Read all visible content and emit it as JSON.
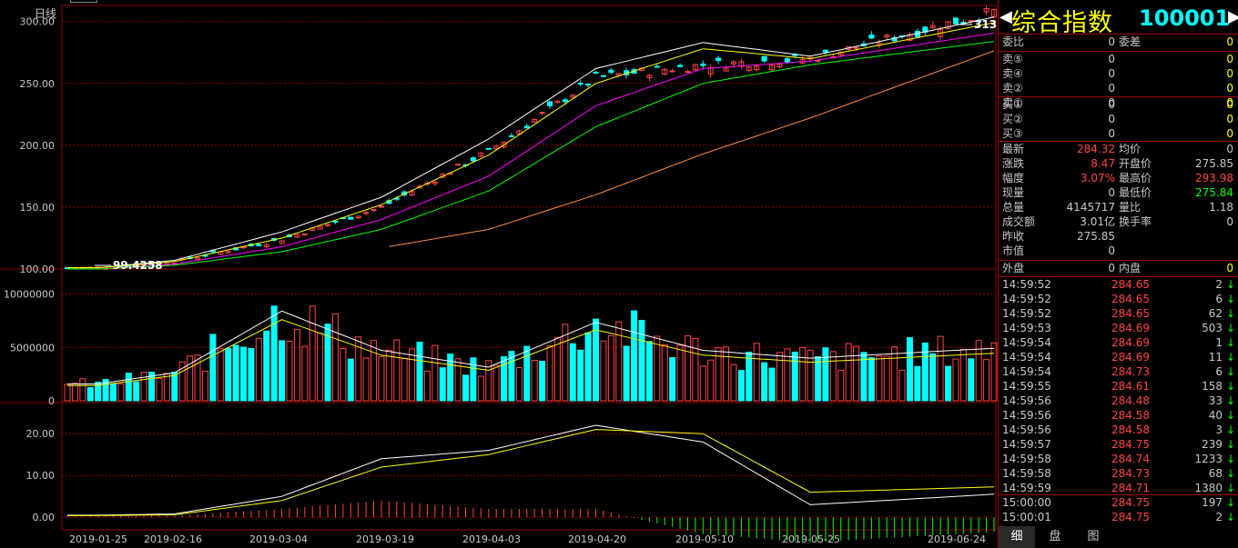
{
  "chart": {
    "period_label": "日线",
    "price_axis": [
      "300.00",
      "250.00",
      "200.00",
      "150.00",
      "100.00"
    ],
    "volume_axis": [
      "10000000",
      "5000000",
      "0"
    ],
    "macd_axis": [
      "20.00",
      "10.00",
      "0.00"
    ],
    "dates": [
      "2019-01-25",
      "2019-02-16",
      "2019-03-04",
      "2019-03-19",
      "2019-04-03",
      "2019-04-20",
      "2019-05-10",
      "2019-05-25",
      "2019-06-24"
    ],
    "high_marker": "313.03",
    "low_marker": "99.4258"
  },
  "colors": {
    "up": "#ff4444",
    "down": "#00ffff",
    "grid": "#8b0000",
    "ma5": "#ffffff",
    "ma10": "#ffff00",
    "ma20": "#ff00ff",
    "ma30": "#00ff00",
    "ma60": "#ff8c3c"
  },
  "chart_data": [
    {
      "type": "candlestick",
      "ylim": [
        100,
        313
      ],
      "x": [
        "2019-01-25",
        "2019-02-16",
        "2019-03-04",
        "2019-03-19",
        "2019-04-03",
        "2019-04-20",
        "2019-05-10",
        "2019-05-25",
        "2019-06-24"
      ],
      "close": [
        101,
        106,
        124,
        150,
        195,
        255,
        265,
        270,
        300
      ],
      "lines": [
        {
          "values": [
            101,
            107,
            130,
            158,
            205,
            262,
            283,
            272,
            297
          ]
        },
        {
          "values": [
            101,
            106,
            125,
            152,
            192,
            250,
            278,
            270,
            293
          ]
        },
        {
          "values": [
            100,
            104,
            118,
            140,
            175,
            232,
            262,
            268,
            286
          ]
        },
        {
          "values": [
            100,
            103,
            114,
            132,
            163,
            215,
            250,
            265,
            280
          ]
        },
        {
          "values": [
            null,
            null,
            null,
            117,
            132,
            160,
            193,
            222,
            265
          ]
        }
      ],
      "annotations": [
        "313.03",
        "99.4258"
      ]
    },
    {
      "type": "bar",
      "ylim": [
        0,
        12000000
      ],
      "x": [
        "2019-01-25",
        "2019-02-16",
        "2019-03-04",
        "2019-03-19",
        "2019-04-03",
        "2019-04-20",
        "2019-05-10",
        "2019-05-25",
        "2019-06-24"
      ],
      "values": [
        1500000,
        2500000,
        8000000,
        4500000,
        3000000,
        7000000,
        4500000,
        3800000,
        4500000
      ]
    },
    {
      "type": "line",
      "ylim": [
        -3,
        27
      ],
      "x": [
        "2019-01-25",
        "2019-02-16",
        "2019-03-04",
        "2019-03-19",
        "2019-04-03",
        "2019-04-20",
        "2019-05-10",
        "2019-05-25",
        "2019-06-24"
      ],
      "series": [
        {
          "values": [
            0.5,
            0.8,
            5,
            14,
            16,
            22,
            18,
            3,
            5
          ]
        },
        {
          "values": [
            0.4,
            0.6,
            4,
            12,
            15,
            21,
            20,
            6,
            7
          ]
        }
      ]
    }
  ],
  "panel": {
    "name": "综合指数",
    "code": "100001",
    "ratio_label": "委比",
    "ratio_value": "0",
    "diff_label": "委差",
    "diff_value": "0",
    "sells": [
      {
        "label": "卖⑤",
        "price": "0",
        "vol": "0"
      },
      {
        "label": "卖④",
        "price": "0",
        "vol": "0"
      },
      {
        "label": "卖②",
        "price": "0",
        "vol": "0"
      },
      {
        "label": "卖①",
        "price": "0",
        "vol": "0"
      }
    ],
    "buys": [
      {
        "label": "买①",
        "price": "0",
        "vol": "0"
      },
      {
        "label": "买②",
        "price": "0",
        "vol": "0"
      },
      {
        "label": "买③",
        "price": "0",
        "vol": "0"
      }
    ],
    "stats": [
      {
        "l1": "最新",
        "v1": "284.32",
        "c1": "#ff4444",
        "l2": "均价",
        "v2": "0",
        "c2": "#c8c8c8"
      },
      {
        "l1": "涨跌",
        "v1": "8.47",
        "c1": "#ff4444",
        "l2": "开盘价",
        "v2": "275.85",
        "c2": "#c8c8c8"
      },
      {
        "l1": "幅度",
        "v1": "3.07%",
        "c1": "#ff4444",
        "l2": "最高价",
        "v2": "293.98",
        "c2": "#ff4444"
      },
      {
        "l1": "现量",
        "v1": "0",
        "c1": "#c8c8c8",
        "l2": "最低价",
        "v2": "275.84",
        "c2": "#00ff00"
      },
      {
        "l1": "总量",
        "v1": "4145717",
        "c1": "#c8c8c8",
        "l2": "量比",
        "v2": "1.18",
        "c2": "#c8c8c8"
      },
      {
        "l1": "成交额",
        "v1": "3.01亿",
        "c1": "#c8c8c8",
        "l2": "换手率",
        "v2": "0",
        "c2": "#c8c8c8"
      },
      {
        "l1": "昨收",
        "v1": "275.85",
        "c1": "#c8c8c8",
        "l2": "",
        "v2": "",
        "c2": "#c8c8c8"
      },
      {
        "l1": "市值",
        "v1": "0",
        "c1": "#c8c8c8",
        "l2": "",
        "v2": "",
        "c2": "#c8c8c8"
      }
    ],
    "outer_label": "外盘",
    "outer_value": "0",
    "inner_label": "内盘",
    "inner_value": "0",
    "ticks": [
      {
        "time": "14:59:52",
        "price": "284.65",
        "vol": "2"
      },
      {
        "time": "14:59:52",
        "price": "284.65",
        "vol": "6"
      },
      {
        "time": "14:59:52",
        "price": "284.65",
        "vol": "62"
      },
      {
        "time": "14:59:53",
        "price": "284.69",
        "vol": "503"
      },
      {
        "time": "14:59:54",
        "price": "284.69",
        "vol": "1"
      },
      {
        "time": "14:59:54",
        "price": "284.69",
        "vol": "11"
      },
      {
        "time": "14:59:54",
        "price": "284.73",
        "vol": "6"
      },
      {
        "time": "14:59:55",
        "price": "284.61",
        "vol": "158"
      },
      {
        "time": "14:59:56",
        "price": "284.48",
        "vol": "33"
      },
      {
        "time": "14:59:56",
        "price": "284.58",
        "vol": "40"
      },
      {
        "time": "14:59:56",
        "price": "284.58",
        "vol": "3"
      },
      {
        "time": "14:59:57",
        "price": "284.75",
        "vol": "239"
      },
      {
        "time": "14:59:58",
        "price": "284.74",
        "vol": "1233"
      },
      {
        "time": "14:59:58",
        "price": "284.73",
        "vol": "68"
      },
      {
        "time": "14:59:59",
        "price": "284.71",
        "vol": "1380"
      },
      {
        "time": "15:00:00",
        "price": "284.75",
        "vol": "197"
      },
      {
        "time": "15:00:01",
        "price": "284.75",
        "vol": "2"
      }
    ],
    "tick_arrow": "↓",
    "tabs": [
      "细",
      "盘",
      "图"
    ]
  }
}
